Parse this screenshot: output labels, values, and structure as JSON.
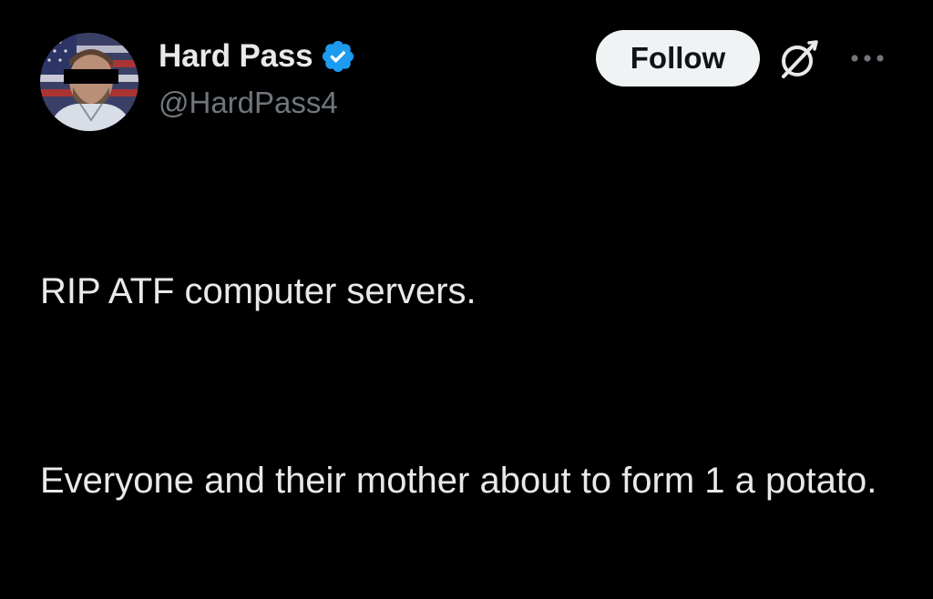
{
  "user": {
    "display_name": "Hard Pass",
    "handle": "@HardPass4",
    "verified": true,
    "verified_color": "#1d9bf0"
  },
  "actions": {
    "follow_label": "Follow",
    "grok_icon": "grok-icon",
    "more_icon": "more-icon"
  },
  "tweet": {
    "paragraphs": [
      "RIP ATF computer servers.",
      "Everyone and their mother about to form 1 a potato."
    ]
  },
  "colors": {
    "background": "#000000",
    "text": "#e7e9ea",
    "secondary_text": "#71767b",
    "button_bg": "#eff3f4"
  }
}
